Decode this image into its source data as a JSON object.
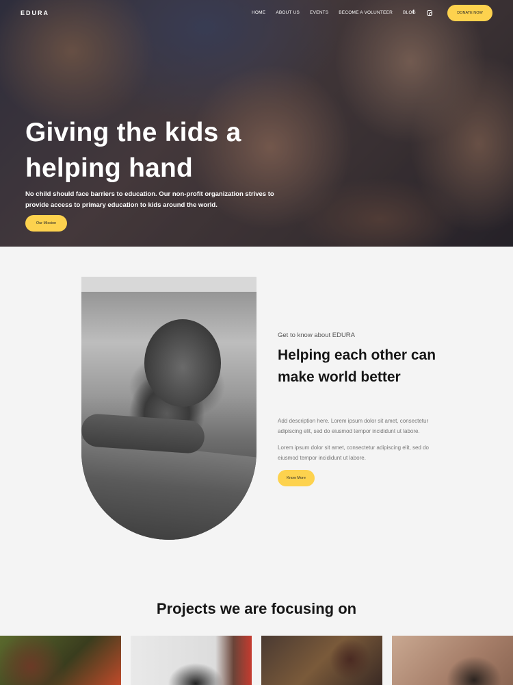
{
  "nav": {
    "logo": "EDURA",
    "links": [
      "HOME",
      "ABOUT US",
      "EVENTS",
      "BECOME A VOLUNTEER",
      "BLOG"
    ],
    "social": [
      "facebook-icon",
      "instagram-icon"
    ],
    "donate_label": "DONATE NOW"
  },
  "hero": {
    "title": "Giving the kids a helping hand",
    "subtitle": "No child should face barriers to education. Our non-profit organization strives to provide access to primary education to kids around the world.",
    "button_label": "Our Mission"
  },
  "about": {
    "kicker": "Get to know about EDURA",
    "title": "Helping each other can make world better",
    "paragraph1": "Add description here. Lorem ipsum dolor sit amet, consectetur adipiscing elit, sed do eiusmod tempor incididunt ut labore.",
    "paragraph2": "Lorem ipsum dolor sit amet, consectetur adipiscing elit, sed do eiusmod tempor incididunt ut labore.",
    "button_label": "Know More"
  },
  "projects": {
    "title": "Projects we are focusing on"
  },
  "colors": {
    "accent": "#fdd24e",
    "background": "#f4f4f4",
    "heading": "#161616"
  }
}
